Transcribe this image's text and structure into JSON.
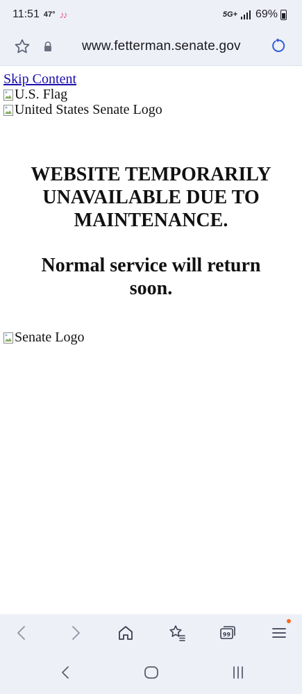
{
  "status_bar": {
    "time": "11:51",
    "temperature": "47°",
    "tiktok_icons": "♪♪",
    "network": "5G+",
    "battery": "69%"
  },
  "browser": {
    "url": "www.fetterman.senate.gov"
  },
  "page": {
    "skip_link": "Skip Content",
    "flag_alt": "U.S. Flag",
    "senate_logo_alt": "United States Senate Logo",
    "maintenance_heading": [
      "WEBSITE TEMPORARILY",
      "UNAVAILABLE DUE TO",
      "MAINTENANCE."
    ],
    "service_message": [
      "Normal service will return",
      "soon."
    ],
    "footer_logo_alt": "Senate Logo"
  },
  "colors": {
    "link": "#1a0dab",
    "notification_dot": "#f26b1d"
  }
}
